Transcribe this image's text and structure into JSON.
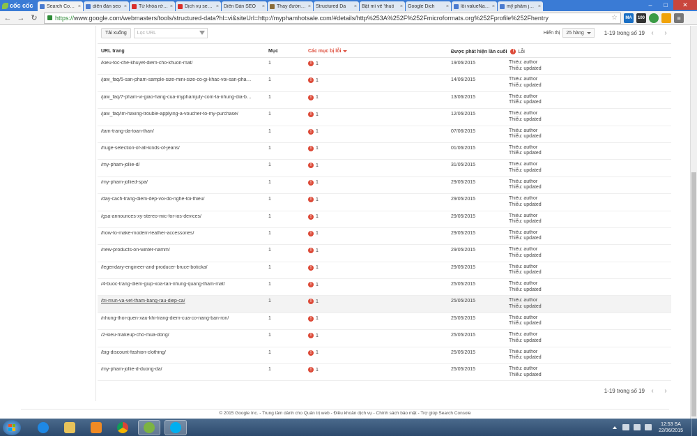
{
  "browser": {
    "brand": "cốc cốc",
    "tabs": [
      {
        "label": "Search Console",
        "favicon": "gsc-favicon-icon",
        "active": true
      },
      {
        "label": "diễn đàn seo",
        "favicon": "google-favicon-icon"
      },
      {
        "label": "Từ khóa rớt m",
        "favicon": "dvs-favicon-icon"
      },
      {
        "label": "Dịch vụ seo, D",
        "favicon": "flag-favicon-icon"
      },
      {
        "label": "Diễn Đàn SEO",
        "favicon": "page-favicon-icon"
      },
      {
        "label": "Thay đường d",
        "favicon": "photo-favicon-icon"
      },
      {
        "label": "Structured Da",
        "favicon": "page-favicon-icon"
      },
      {
        "label": "Bật mí về 'thuố",
        "favicon": "page-favicon-icon"
      },
      {
        "label": "Google Dịch",
        "favicon": "page-favicon-icon"
      },
      {
        "label": "lỗi valueName",
        "favicon": "google-favicon-icon"
      },
      {
        "label": "mỹ phẩm jollie",
        "favicon": "google-favicon-icon"
      }
    ],
    "url_scheme": "https://",
    "url_rest": "www.google.com/webmasters/tools/structured-data?hl=vi&siteUrl=http://myphamhotsale.com/#details/http%253A%252F%252Fmicroformats.org%252Fprofile%252Fhentry",
    "ext_labels": [
      "MA",
      "100"
    ]
  },
  "controls": {
    "download_label": "Tải xuống",
    "filter_placeholder": "Lọc URL",
    "show_label": "Hiển thị",
    "rows_select": "25 hàng",
    "pagination": "1-19 trong số 19"
  },
  "table": {
    "headers": {
      "url": "URL trang",
      "items": "Mục",
      "error_items": "Các mục bị lỗi",
      "detected": "Được phát hiện lần cuối",
      "error": "Lỗi"
    },
    "rows": [
      {
        "url": "/kieu-toc-che-khuyet-diem-cho-khuon-mat/",
        "items": "1",
        "errors": "1",
        "date": "19/06/2015",
        "miss1": "Thiếu: author",
        "miss2": "Thiếu: updated"
      },
      {
        "url": "/jaw_faq/5-san-pham-sample-size-mini-size-co-gi-khac-voi-san-pha…",
        "items": "1",
        "errors": "1",
        "date": "14/06/2015",
        "miss1": "Thiếu: author",
        "miss2": "Thiếu: updated"
      },
      {
        "url": "/jaw_faq/7-pham-vi-giao-hang-cua-myphamjuly-com-la-nhung-dia-b…",
        "items": "1",
        "errors": "1",
        "date": "13/06/2015",
        "miss1": "Thiếu: author",
        "miss2": "Thiếu: updated"
      },
      {
        "url": "/jaw_faq/im-having-trouble-applying-a-voucher-to-my-purchase/",
        "items": "1",
        "errors": "1",
        "date": "12/06/2015",
        "miss1": "Thiếu: author",
        "miss2": "Thiếu: updated"
      },
      {
        "url": "/tam-trang-da-toan-than/",
        "items": "1",
        "errors": "1",
        "date": "07/06/2015",
        "miss1": "Thiếu: author",
        "miss2": "Thiếu: updated"
      },
      {
        "url": "/huge-selection-of-all-kinds-of-jeans/",
        "items": "1",
        "errors": "1",
        "date": "01/06/2015",
        "miss1": "Thiếu: author",
        "miss2": "Thiếu: updated"
      },
      {
        "url": "/my-pham-jollie-d/",
        "items": "1",
        "errors": "1",
        "date": "31/05/2015",
        "miss1": "Thiếu: author",
        "miss2": "Thiếu: updated"
      },
      {
        "url": "/my-pham-jollied-spa/",
        "items": "1",
        "errors": "1",
        "date": "29/05/2015",
        "miss1": "Thiếu: author",
        "miss2": "Thiếu: updated"
      },
      {
        "url": "/day-cach-trang-diem-dep-voi-do-nghe-toi-thieu/",
        "items": "1",
        "errors": "1",
        "date": "29/05/2015",
        "miss1": "Thiếu: author",
        "miss2": "Thiếu: updated"
      },
      {
        "url": "/gsa-announces-xy-stereo-mic-for-ios-devices/",
        "items": "1",
        "errors": "1",
        "date": "29/05/2015",
        "miss1": "Thiếu: author",
        "miss2": "Thiếu: updated"
      },
      {
        "url": "/how-to-make-modern-leather-accessories/",
        "items": "1",
        "errors": "1",
        "date": "29/05/2015",
        "miss1": "Thiếu: author",
        "miss2": "Thiếu: updated"
      },
      {
        "url": "/new-products-on-winter-namm/",
        "items": "1",
        "errors": "1",
        "date": "29/05/2015",
        "miss1": "Thiếu: author",
        "miss2": "Thiếu: updated"
      },
      {
        "url": "/legendary-engineer-and-producer-bruce-boticka/",
        "items": "1",
        "errors": "1",
        "date": "29/05/2015",
        "miss1": "Thiếu: author",
        "miss2": "Thiếu: updated"
      },
      {
        "url": "/4-buoc-trang-diem-giup-xoa-tan-nhung-quang-tham-mat/",
        "items": "1",
        "errors": "1",
        "date": "25/05/2015",
        "miss1": "Thiếu: author",
        "miss2": "Thiếu: updated"
      },
      {
        "url": "/tri-mun-va-vet-tham-bang-rau-diep-ca/",
        "items": "1",
        "errors": "1",
        "date": "25/05/2015",
        "miss1": "Thiếu: author",
        "miss2": "Thiếu: updated",
        "highlight": true
      },
      {
        "url": "/nhung-thoi-quen-xau-khi-trang-diem-cua-co-nang-ban-ron/",
        "items": "1",
        "errors": "1",
        "date": "25/05/2015",
        "miss1": "Thiếu: author",
        "miss2": "Thiếu: updated"
      },
      {
        "url": "/2-kieu-makeup-cho-mua-dong/",
        "items": "1",
        "errors": "1",
        "date": "25/05/2015",
        "miss1": "Thiếu: author",
        "miss2": "Thiếu: updated"
      },
      {
        "url": "/big-discount-fashion-clothing/",
        "items": "1",
        "errors": "1",
        "date": "25/05/2015",
        "miss1": "Thiếu: author",
        "miss2": "Thiếu: updated"
      },
      {
        "url": "/my-pham-jollie-d-duong-da/",
        "items": "1",
        "errors": "1",
        "date": "25/05/2015",
        "miss1": "Thiếu: author",
        "miss2": "Thiếu: updated"
      }
    ]
  },
  "footer": "© 2015 Google Inc. - Trung tâm dành cho Quản trị web - Điều khoản dịch vụ - Chính sách bảo mật - Trợ giúp Search Console",
  "taskbar": {
    "apps": [
      "ie-icon",
      "explorer-icon",
      "media-player-icon",
      "chrome-icon",
      "coccoc-icon",
      "skype-icon"
    ],
    "time": "12:53 SA",
    "date": "22/06/2015"
  },
  "colors": {
    "error_red": "#dd4b39",
    "tab_blue": "#3a7bd5",
    "secure_green": "#2e8b36"
  }
}
